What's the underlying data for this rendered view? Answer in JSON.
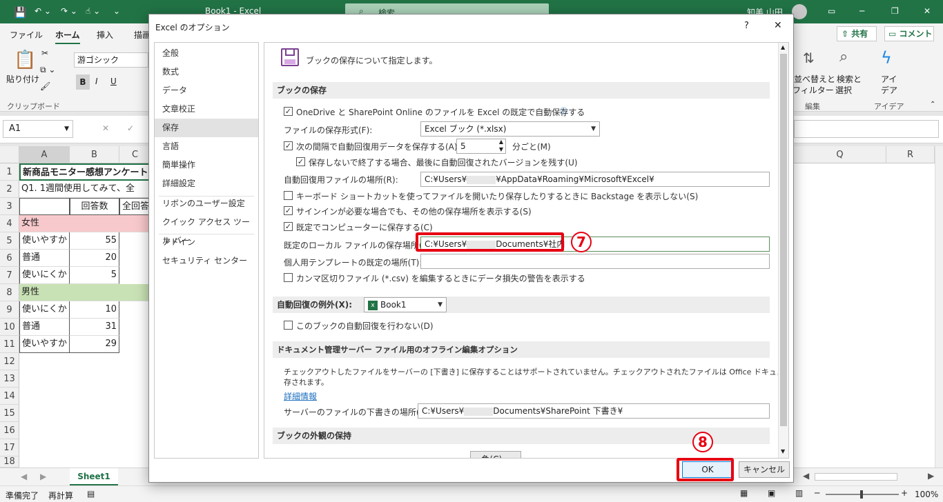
{
  "titlebar": {
    "book": "Book1  -  Excel",
    "search": "検索",
    "user": "知美 山田"
  },
  "ribbon_tabs": [
    "ファイル",
    "ホーム",
    "挿入",
    "描画"
  ],
  "ribbon": {
    "paste": "貼り付け",
    "clipboard": "クリップボード",
    "font": "游ゴシック",
    "bold": "B",
    "italic": "I",
    "underline": "U",
    "sort": "並べ替えと",
    "filter": "フィルター",
    "find": "検索と",
    "select": "選択",
    "edit_group": "編集",
    "ideas1": "アイ",
    "ideas2": "デア",
    "ideas_group": "アイデア",
    "share": "共有",
    "comment": "コメント"
  },
  "namebox": "A1",
  "columns": [
    "A",
    "B",
    "C",
    "Q",
    "R"
  ],
  "rows": [
    "1",
    "2",
    "3",
    "4",
    "5",
    "6",
    "7",
    "8",
    "9",
    "10",
    "11",
    "12",
    "13",
    "14",
    "15",
    "16",
    "17",
    "18"
  ],
  "cells": {
    "r1": "新商品モニター感想アンケート",
    "r2": "Q1. 1週間使用してみて、全",
    "r3b": "回答数",
    "r3c": "全回答",
    "r4": "女性",
    "r5a": "使いやすか",
    "r5b": "55",
    "r6a": "普通",
    "r6b": "20",
    "r7a": "使いにくか",
    "r7b": "5",
    "r8": "男性",
    "r9a": "使いにくか",
    "r9b": "10",
    "r10a": "普通",
    "r10b": "31",
    "r11a": "使いやすか",
    "r11b": "29"
  },
  "sheet_tab": "Sheet1",
  "status": {
    "ready": "準備完了",
    "recalc": "再計算",
    "zoom": "100%"
  },
  "dialog": {
    "title": "Excel のオプション",
    "help": "?",
    "close": "✕",
    "nav": [
      "全般",
      "数式",
      "データ",
      "文章校正",
      "保存",
      "言語",
      "簡単操作",
      "詳細設定",
      "リボンのユーザー設定",
      "クイック アクセス ツール バー",
      "アドイン",
      "セキュリティ センター"
    ],
    "heading": "ブックの保存について指定します。",
    "sec_save": "ブックの保存",
    "autosave_onedrive": "OneDrive と SharePoint Online のファイルを Excel の既定で自動保存する",
    "format_label": "ファイルの保存形式(F):",
    "format_value": "Excel ブック (*.xlsx)",
    "autorecover_label": "次の間隔で自動回復用データを保存する(A):",
    "autorecover_minutes": "5",
    "minutes_unit": "分ごと(M)",
    "keep_last": "保存しないで終了する場合、最後に自動回復されたバージョンを残す(U)",
    "ar_location_label": "自動回復用ファイルの場所(R):",
    "ar_location_prefix": "C:¥Users¥",
    "ar_location_suffix": "¥AppData¥Roaming¥Microsoft¥Excel¥",
    "no_backstage": "キーボード ショートカットを使ってファイルを開いたり保存したりするときに Backstage を表示しない(S)",
    "show_more": "サインインが必要な場合でも、その他の保存場所を表示する(S)",
    "save_computer": "既定でコンピューターに保存する(C)",
    "local_label": "既定のローカル ファイルの保存場所(I):",
    "local_prefix": "C:¥Users¥",
    "local_suffix": "Documents¥社内",
    "template_label": "個人用テンプレートの既定の場所(T):",
    "csv_warn": "カンマ区切りファイル (*.csv) を編集するときにデータ損失の警告を表示する",
    "sec_except": "自動回復の例外(X):",
    "except_book": "Book1",
    "disable_ar": "このブックの自動回復を行わない(D)",
    "sec_offline": "ドキュメント管理サーバー ファイル用のオフライン編集オプション",
    "offline_text1": "チェックアウトしたファイルをサーバーの [下書き] に保存することはサポートされていません。チェックアウトされたファイルは Office ドキュメント キャッシュに保",
    "offline_text2": "存されます。",
    "more_info": "詳細情報",
    "drafts_label": "サーバーのファイルの下書きの場所(V):",
    "drafts_prefix": "C:¥Users¥",
    "drafts_suffix": "Documents¥SharePoint 下書き¥",
    "sec_visual": "ブックの外観の保持",
    "colors_btn": "色(C)...",
    "ok": "OK",
    "cancel": "キャンセル"
  },
  "annotations": {
    "step7": "7",
    "step8": "8"
  }
}
